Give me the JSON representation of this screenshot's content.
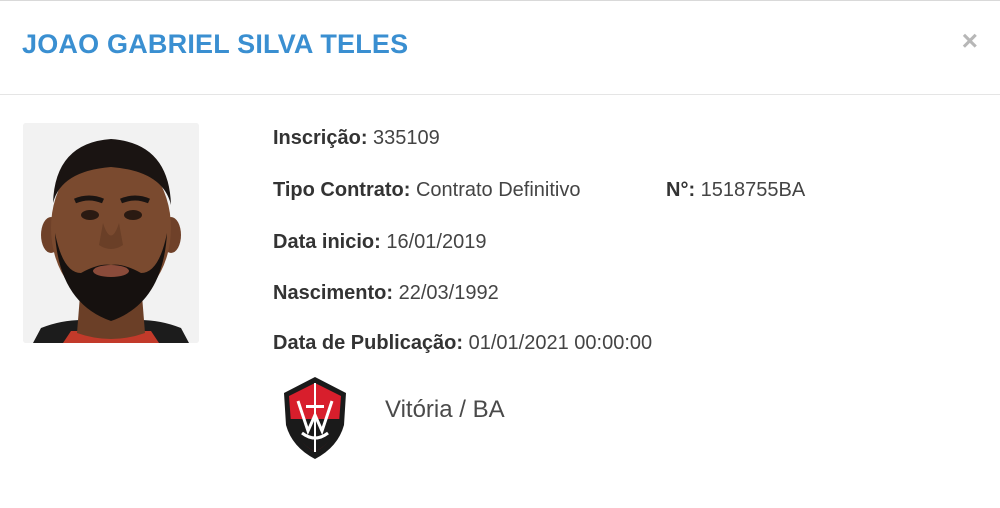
{
  "modal": {
    "title": "JOAO GABRIEL SILVA TELES",
    "close_label": "×"
  },
  "player": {
    "inscricao_label": "Inscrição:",
    "inscricao_value": "335109",
    "tipo_contrato_label": "Tipo Contrato:",
    "tipo_contrato_value": "Contrato Definitivo",
    "numero_label": "N°:",
    "numero_value": "1518755BA",
    "data_inicio_label": "Data inicio:",
    "data_inicio_value": "16/01/2019",
    "nascimento_label": "Nascimento:",
    "nascimento_value": "22/03/1992",
    "data_publicacao_label": "Data de Publicação:",
    "data_publicacao_value": "01/01/2021 00:00:00"
  },
  "club": {
    "name": "Vitória / BA",
    "logo_icon": "club-crest-icon",
    "colors": {
      "red": "#d81e2c",
      "black": "#1a1a1a",
      "white": "#ffffff"
    }
  }
}
